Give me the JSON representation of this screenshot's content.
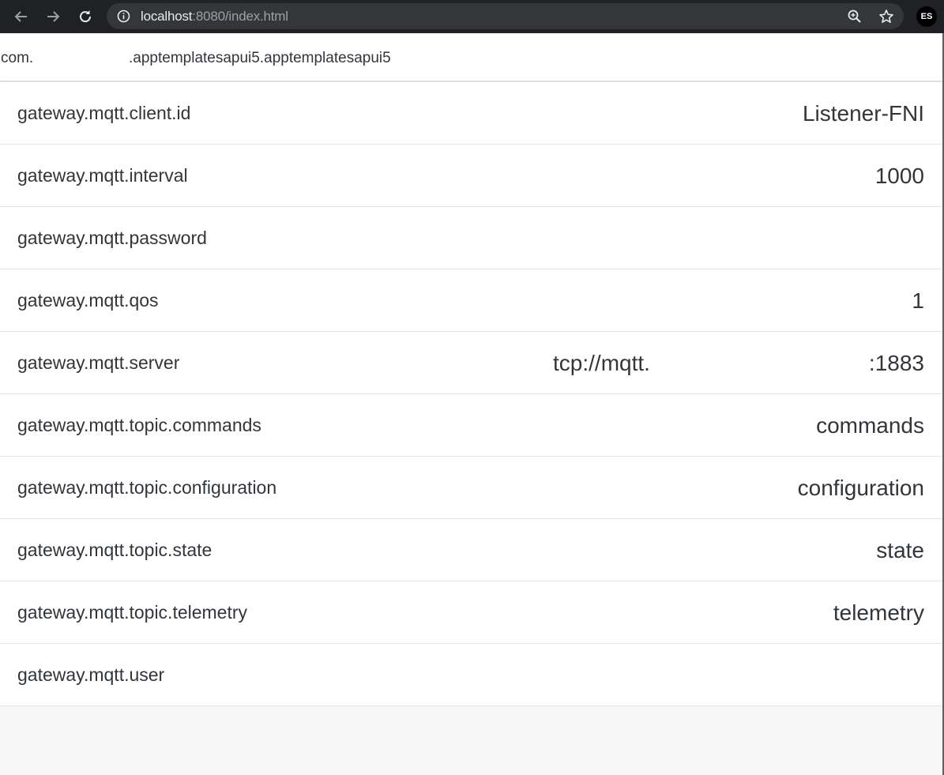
{
  "browser": {
    "back_icon": "arrow-left-icon",
    "forward_icon": "arrow-right-icon",
    "reload_icon": "reload-icon",
    "info_icon": "info-icon",
    "url_host": "localhost",
    "url_rest": ":8080/index.html",
    "zoom_icon": "zoom-icon",
    "star_icon": "star-icon",
    "profile_initials": "ES"
  },
  "header": {
    "title_part1": "com.",
    "title_part2": ".apptemplatesapui5.apptemplatesapui5"
  },
  "properties": [
    {
      "key": "gateway.mqtt.client.id",
      "value": "Listener-FNI"
    },
    {
      "key": "gateway.mqtt.interval",
      "value": "1000"
    },
    {
      "key": "gateway.mqtt.password",
      "value": ""
    },
    {
      "key": "gateway.mqtt.qos",
      "value": "1"
    },
    {
      "key": "gateway.mqtt.server",
      "value_part1": "tcp://mqtt.",
      "value": ":1883"
    },
    {
      "key": "gateway.mqtt.topic.commands",
      "value": "commands"
    },
    {
      "key": "gateway.mqtt.topic.configuration",
      "value": "configuration"
    },
    {
      "key": "gateway.mqtt.topic.state",
      "value": "state"
    },
    {
      "key": "gateway.mqtt.topic.telemetry",
      "value": "telemetry"
    },
    {
      "key": "gateway.mqtt.user",
      "value": ""
    }
  ],
  "colors": {
    "chrome_bar": "#202124",
    "omnibox": "#35363a",
    "text": "#32363a",
    "background": "#f7f7f7"
  }
}
